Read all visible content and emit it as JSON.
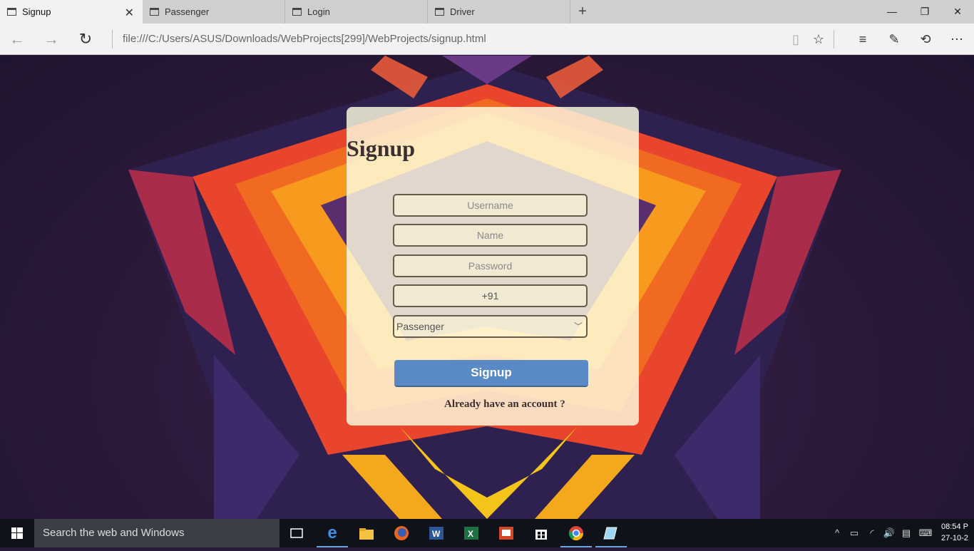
{
  "browser": {
    "tabs": [
      {
        "label": "Signup",
        "active": true
      },
      {
        "label": "Passenger",
        "active": false
      },
      {
        "label": "Login",
        "active": false
      },
      {
        "label": "Driver",
        "active": false
      }
    ],
    "url": "file:///C:/Users/ASUS/Downloads/WebProjects[299]/WebProjects/signup.html"
  },
  "form": {
    "title": "Signup",
    "username_placeholder": "Username",
    "name_placeholder": "Name",
    "password_placeholder": "Password",
    "phone_value": "+91",
    "role_selected": "Passenger",
    "submit_label": "Signup",
    "login_link": "Already have an account ?"
  },
  "taskbar": {
    "search_placeholder": "Search the web and Windows",
    "time": "08:54 P",
    "date": "27-10-2"
  },
  "colors": {
    "card": "#fffde0",
    "button": "#5a8ac5",
    "taskbar": "#0f1218"
  }
}
